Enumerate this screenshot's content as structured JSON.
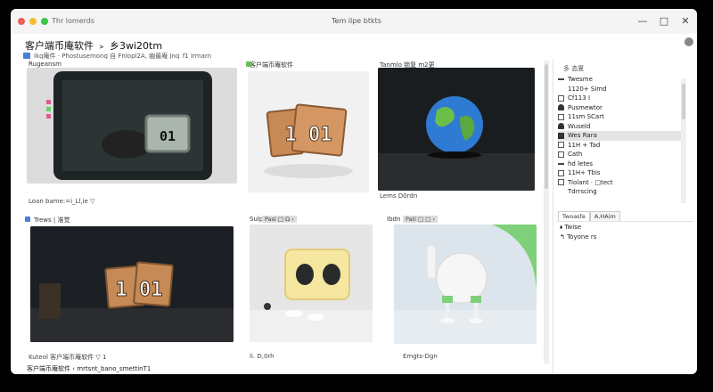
{
  "window": {
    "title": "Thr lomerds",
    "center_title": "Tem ilpe btkts",
    "controls": [
      "—",
      "□",
      "✕"
    ]
  },
  "header": {
    "heading": "客户端币庵软件 ﹥ 乡3wi20tm",
    "subtitle": "Ikg庵件 · Phostusemong 自 Fnlopl2A,  幽最庵 Jnq_f1 Irmarn"
  },
  "cards": [
    {
      "title": "Rugeansm",
      "footer": "Loan bame:=i_Ll,ie ▽",
      "label": "01"
    },
    {
      "title": "客户端币庵软件",
      "footer": "",
      "label": "1 01"
    },
    {
      "title": "Tanmlo 锁复 m2更",
      "footer": "Lems D0rdn",
      "label": "globe"
    },
    {
      "title": "Trews | 准觉",
      "footer": "Kuteol 客户端币庵软件 ▽ 1",
      "label": "1 01"
    },
    {
      "title": "Sulpre ⊂Line",
      "footer": "li. D,0rh",
      "overlay": "Pasi □ Ω ›",
      "label": "switch"
    },
    {
      "title": "Ibdn Pigo",
      "footer": "Emgts-Dgn",
      "overlay": "Pati □ □ ›",
      "label": "robot"
    }
  ],
  "right_panel": {
    "title": "多 态夏",
    "tree": [
      {
        "label": "Twesme",
        "icon": "line"
      },
      {
        "label": "1120+ Simd",
        "icon": "none"
      },
      {
        "label": "Cf113 I",
        "icon": "box"
      },
      {
        "label": "Pusmewtor",
        "icon": "cloud"
      },
      {
        "label": "11sm SCart",
        "icon": "box"
      },
      {
        "label": "Wuseld",
        "icon": "cloud"
      },
      {
        "label": "Wes Rara",
        "icon": "dark",
        "selected": true
      },
      {
        "label": "11H + Tad",
        "icon": "box"
      },
      {
        "label": "Cath",
        "icon": "box"
      },
      {
        "label": "hd letes",
        "icon": "line"
      },
      {
        "label": "11H+ Tbis",
        "icon": "box"
      },
      {
        "label": "Tiolant · □tect",
        "icon": "box"
      },
      {
        "label": "Tdrrscing",
        "icon": "none"
      }
    ],
    "tabs": [
      "Twoasfe",
      "A,HAim"
    ],
    "actions": [
      "⬧ Twise",
      "↰ Toyone rs"
    ]
  },
  "status": {
    "text": "客户端币庵软件 ‹ mrtsnt_bano_smettinT1"
  }
}
